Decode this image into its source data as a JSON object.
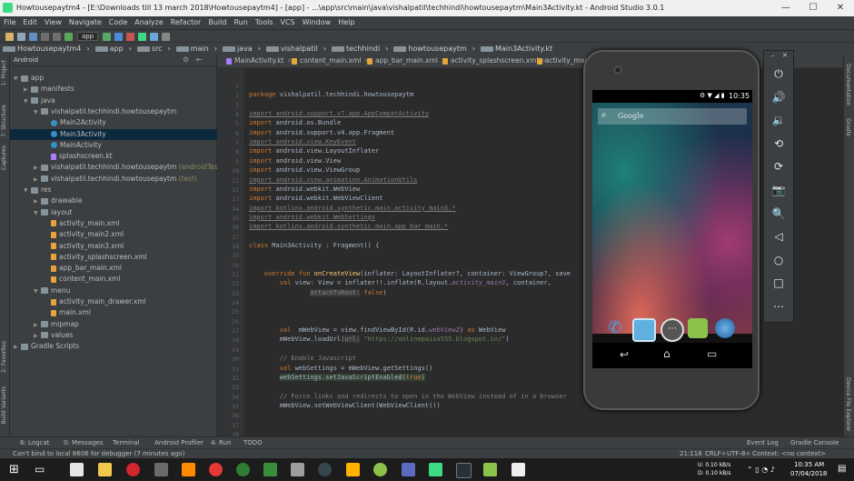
{
  "window": {
    "title": "Howtousepaytm4 - [E:\\Downloads till 13 march 2018\\Howtousepaytm4] - [app] - ...\\app\\src\\main\\java\\vishalpatil\\techhindi\\howtousepaytm\\Main3Activity.kt - Android Studio 3.0.1",
    "min": "—",
    "max": "☐",
    "close": "✕"
  },
  "menu": [
    "File",
    "Edit",
    "View",
    "Navigate",
    "Code",
    "Analyze",
    "Refactor",
    "Build",
    "Run",
    "Tools",
    "VCS",
    "Window",
    "Help"
  ],
  "toolbar": {
    "config": "app"
  },
  "breadcrumb": [
    "Howtousepaytm4",
    "app",
    "src",
    "main",
    "java",
    "vishalpatil",
    "techhindi",
    "howtousepaytm",
    "Main3Activity.kt"
  ],
  "project": {
    "view": "Android",
    "tree": [
      {
        "label": "app",
        "suffix": "",
        "depth": 0,
        "arrow": "▼",
        "icon": "folder"
      },
      {
        "label": "manifests",
        "suffix": "",
        "depth": 1,
        "arrow": "▶",
        "icon": "folder"
      },
      {
        "label": "java",
        "suffix": "",
        "depth": 1,
        "arrow": "▼",
        "icon": "folder"
      },
      {
        "label": "vishalpatil.techhindi.howtousepaytm",
        "suffix": "",
        "depth": 2,
        "arrow": "▼",
        "icon": "folder"
      },
      {
        "label": "Main2Activity",
        "suffix": "",
        "depth": 3,
        "arrow": "",
        "icon": "cls"
      },
      {
        "label": "Main3Activity",
        "suffix": "",
        "depth": 3,
        "arrow": "",
        "icon": "cls",
        "selected": true
      },
      {
        "label": "MainActivity",
        "suffix": "",
        "depth": 3,
        "arrow": "",
        "icon": "cls"
      },
      {
        "label": "splashscreen.kt",
        "suffix": "",
        "depth": 3,
        "arrow": "",
        "icon": "kt"
      },
      {
        "label": "vishalpatil.techhindi.howtousepaytm",
        "suffix": " (androidTest)",
        "depth": 2,
        "arrow": "▶",
        "icon": "folder"
      },
      {
        "label": "vishalpatil.techhindi.howtousepaytm",
        "suffix": " (test)",
        "depth": 2,
        "arrow": "▶",
        "icon": "folder"
      },
      {
        "label": "res",
        "suffix": "",
        "depth": 1,
        "arrow": "▼",
        "icon": "folder"
      },
      {
        "label": "drawable",
        "suffix": "",
        "depth": 2,
        "arrow": "▶",
        "icon": "folder"
      },
      {
        "label": "layout",
        "suffix": "",
        "depth": 2,
        "arrow": "▼",
        "icon": "folder"
      },
      {
        "label": "activity_main.xml",
        "suffix": "",
        "depth": 3,
        "arrow": "",
        "icon": "xml"
      },
      {
        "label": "activity_main2.xml",
        "suffix": "",
        "depth": 3,
        "arrow": "",
        "icon": "xml"
      },
      {
        "label": "activity_main3.xml",
        "suffix": "",
        "depth": 3,
        "arrow": "",
        "icon": "xml"
      },
      {
        "label": "activity_splashscreen.xml",
        "suffix": "",
        "depth": 3,
        "arrow": "",
        "icon": "xml"
      },
      {
        "label": "app_bar_main.xml",
        "suffix": "",
        "depth": 3,
        "arrow": "",
        "icon": "xml"
      },
      {
        "label": "content_main.xml",
        "suffix": "",
        "depth": 3,
        "arrow": "",
        "icon": "xml"
      },
      {
        "label": "menu",
        "suffix": "",
        "depth": 2,
        "arrow": "▼",
        "icon": "folder"
      },
      {
        "label": "activity_main_drawer.xml",
        "suffix": "",
        "depth": 3,
        "arrow": "",
        "icon": "xml"
      },
      {
        "label": "main.xml",
        "suffix": "",
        "depth": 3,
        "arrow": "",
        "icon": "xml"
      },
      {
        "label": "mipmap",
        "suffix": "",
        "depth": 2,
        "arrow": "▶",
        "icon": "folder"
      },
      {
        "label": "values",
        "suffix": "",
        "depth": 2,
        "arrow": "▶",
        "icon": "folder"
      },
      {
        "label": "Gradle Scripts",
        "suffix": "",
        "depth": 0,
        "arrow": "▶",
        "icon": "folder"
      }
    ]
  },
  "side_tabs": {
    "project": "1: Project",
    "structure": "7: Structure",
    "captures": "Captures",
    "favorites": "2: Favorites",
    "build_variants": "Build Variants",
    "documentation": "Documentation",
    "gradle": "Gradle",
    "device_explorer": "Device File Explorer"
  },
  "editor_tabs": [
    "MainActivity.kt",
    "content_main.xml",
    "app_bar_main.xml",
    "activity_splashscreen.xml",
    "activity_main_dr"
  ],
  "code_lines": [
    {
      "n": "1",
      "html": ""
    },
    {
      "n": "2",
      "html": "<span class='k'>package</span> vishalpatil.techhindi.howtousepaytm"
    },
    {
      "n": "3",
      "html": ""
    },
    {
      "n": "4",
      "html": "<span class='u'>import android.support.v7.app.AppCompatActivity</span>"
    },
    {
      "n": "5",
      "html": "<span class='k'>import</span> android.os.Bundle"
    },
    {
      "n": "6",
      "html": "<span class='k'>import</span> android.support.v4.app.Fragment"
    },
    {
      "n": "7",
      "html": "<span class='u'>import android.view.KeyEvent</span>"
    },
    {
      "n": "8",
      "html": "<span class='k'>import</span> android.view.LayoutInflater"
    },
    {
      "n": "9",
      "html": "<span class='k'>import</span> android.view.View"
    },
    {
      "n": "10",
      "html": "<span class='k'>import</span> android.view.ViewGroup"
    },
    {
      "n": "11",
      "html": "<span class='u'>import android.view.animation.AnimationUtils</span>"
    },
    {
      "n": "12",
      "html": "<span class='k'>import</span> android.webkit.WebView"
    },
    {
      "n": "13",
      "html": "<span class='k'>import</span> android.webkit.WebViewClient"
    },
    {
      "n": "14",
      "html": "<span class='u'>import kotlinx.android.synthetic.main.activity_main3.*</span>"
    },
    {
      "n": "15",
      "html": "<span class='u'>import android.webkit.WebSettings</span>"
    },
    {
      "n": "16",
      "html": "<span class='u'>import kotlinx.android.synthetic.main.app_bar_main.*</span>"
    },
    {
      "n": "17",
      "html": ""
    },
    {
      "n": "18",
      "html": "<span class='k'>class</span> Main3Activity : Fragment() {"
    },
    {
      "n": "19",
      "html": ""
    },
    {
      "n": "20",
      "html": ""
    },
    {
      "n": "21",
      "html": "    <span class='k'>override fun</span> <span class='f'>onCreateView</span>(inflater: LayoutInflater?, container: ViewGroup?, save"
    },
    {
      "n": "22",
      "html": "        <span class='k'>val</span> view: View = inflater!!.inflate(R.layout.<span class='p'>activity_main3</span>, container,"
    },
    {
      "n": "23",
      "html": "                <span style='background:#3b3b3b;color:#888'>attachToRoot:</span> <span class='k'>false</span>)"
    },
    {
      "n": "24",
      "html": ""
    },
    {
      "n": "25",
      "html": ""
    },
    {
      "n": "26",
      "html": ""
    },
    {
      "n": "27",
      "html": "        <span class='k'>val</span>  mWebView = view.findViewById(R.id.<span class='p'>webView2</span>) <span class='k'>as</span> WebView"
    },
    {
      "n": "28",
      "html": "        mWebView.loadUrl(<span style='background:#3b3b3b;color:#888'>url:</span> <span class='s'>\"https://onlinepaisa555.blogspot.in/\"</span>)"
    },
    {
      "n": "29",
      "html": ""
    },
    {
      "n": "30",
      "html": "        <span class='c'>// Enable Javascript</span>"
    },
    {
      "n": "31",
      "html": "        <span class='k'>val</span> webSettings = mWebView.getSettings()"
    },
    {
      "n": "32",
      "html": "        <span class='hl'>webSettings.setJavaScriptEnabled(<span class='k'>true</span>)</span>"
    },
    {
      "n": "33",
      "html": ""
    },
    {
      "n": "34",
      "html": "        <span class='c'>// Force links and redirects to open in the WebView instead of in a browser</span>"
    },
    {
      "n": "35",
      "html": "        mWebView.setWebViewClient(WebViewClient())"
    },
    {
      "n": "36",
      "html": ""
    },
    {
      "n": "37",
      "html": ""
    },
    {
      "n": "38",
      "html": ""
    },
    {
      "n": "39",
      "html": ""
    },
    {
      "n": "40",
      "html": ""
    }
  ],
  "emulator": {
    "time": "10:35",
    "search_placeholder": "Google",
    "controls": [
      {
        "name": "power-icon",
        "glyph": "⏻"
      },
      {
        "name": "volume-up-icon",
        "glyph": "🔊"
      },
      {
        "name": "volume-down-icon",
        "glyph": "🔉"
      },
      {
        "name": "rotate-left-icon",
        "glyph": "⟲"
      },
      {
        "name": "rotate-right-icon",
        "glyph": "⟳"
      },
      {
        "name": "camera-icon",
        "glyph": "📷"
      },
      {
        "name": "zoom-icon",
        "glyph": "🔍"
      },
      {
        "name": "back-icon",
        "glyph": "◁"
      },
      {
        "name": "home-icon",
        "glyph": "○"
      },
      {
        "name": "overview-icon",
        "glyph": "□"
      },
      {
        "name": "more-icon",
        "glyph": "⋯"
      }
    ]
  },
  "bottom_tools": {
    "logcat": "6: Logcat",
    "messages": "0: Messages",
    "terminal": "Terminal",
    "profiler": "Android Profiler",
    "run": "4: Run",
    "todo": "TODO",
    "event_log": "Event Log",
    "gradle_console": "Gradle Console"
  },
  "status": {
    "message": "Can't bind to local 8606 for debugger (7 minutes ago)",
    "position": "21:118",
    "line_sep": "CRLF÷",
    "encoding": "UTF-8÷",
    "context": "Context: <no context>"
  },
  "taskbar": {
    "time": "10:35 AM",
    "date": "07/04/2018",
    "upload": "U: 0.10 kB/s",
    "download": "D: 0.10 kB/s"
  },
  "colors": {
    "accent": "#3592c4",
    "android_green": "#3ddc84"
  }
}
